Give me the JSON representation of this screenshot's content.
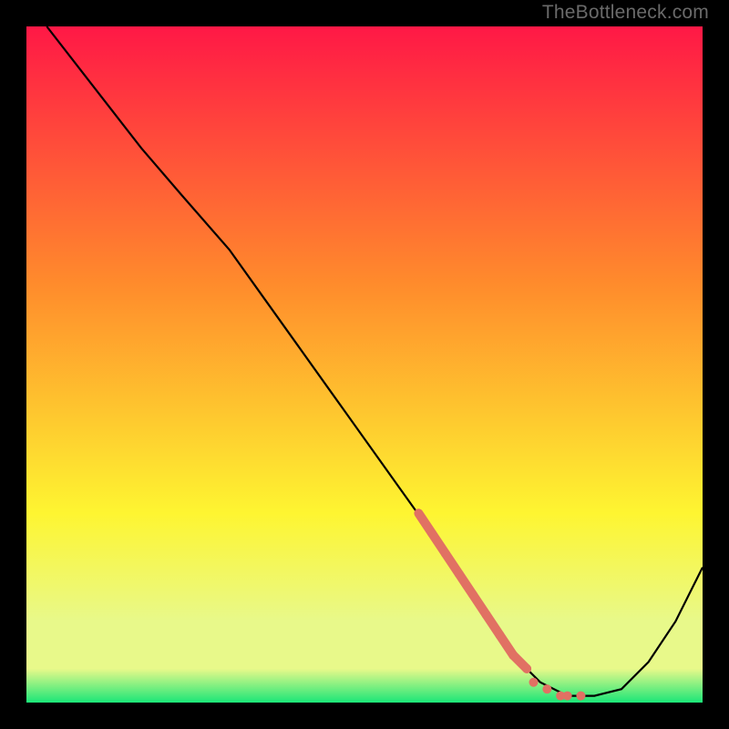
{
  "watermark": "TheBottleneck.com",
  "colors": {
    "top_red": "#ff1846",
    "orange": "#ff8b2c",
    "yellow": "#fef531",
    "pale": "#e8f98a",
    "green": "#1be678",
    "curve": "#000000",
    "marker": "#e17163",
    "frame": "#000000"
  },
  "chart_data": {
    "type": "line",
    "title": "",
    "xlabel": "",
    "ylabel": "",
    "xlim": [
      0,
      100
    ],
    "ylim": [
      0,
      100
    ],
    "grid": false,
    "series": [
      {
        "name": "bottleneck-curve",
        "x": [
          3,
          10,
          17,
          23,
          30,
          35,
          40,
          45,
          50,
          55,
          60,
          64,
          68,
          72,
          76,
          80,
          84,
          88,
          92,
          96,
          100
        ],
        "y": [
          100,
          91,
          82,
          75,
          67,
          60,
          53,
          46,
          39,
          32,
          25,
          19,
          13,
          7,
          3,
          1,
          1,
          2,
          6,
          12,
          20
        ]
      }
    ],
    "markers": {
      "name": "highlighted-range",
      "x": [
        58,
        60,
        62,
        64,
        66,
        68,
        70,
        72,
        74,
        75,
        77,
        79,
        80,
        82
      ],
      "y": [
        28,
        25,
        22,
        19,
        16,
        13,
        10,
        7,
        5,
        3,
        2,
        1,
        1,
        1
      ]
    },
    "legend": false
  }
}
